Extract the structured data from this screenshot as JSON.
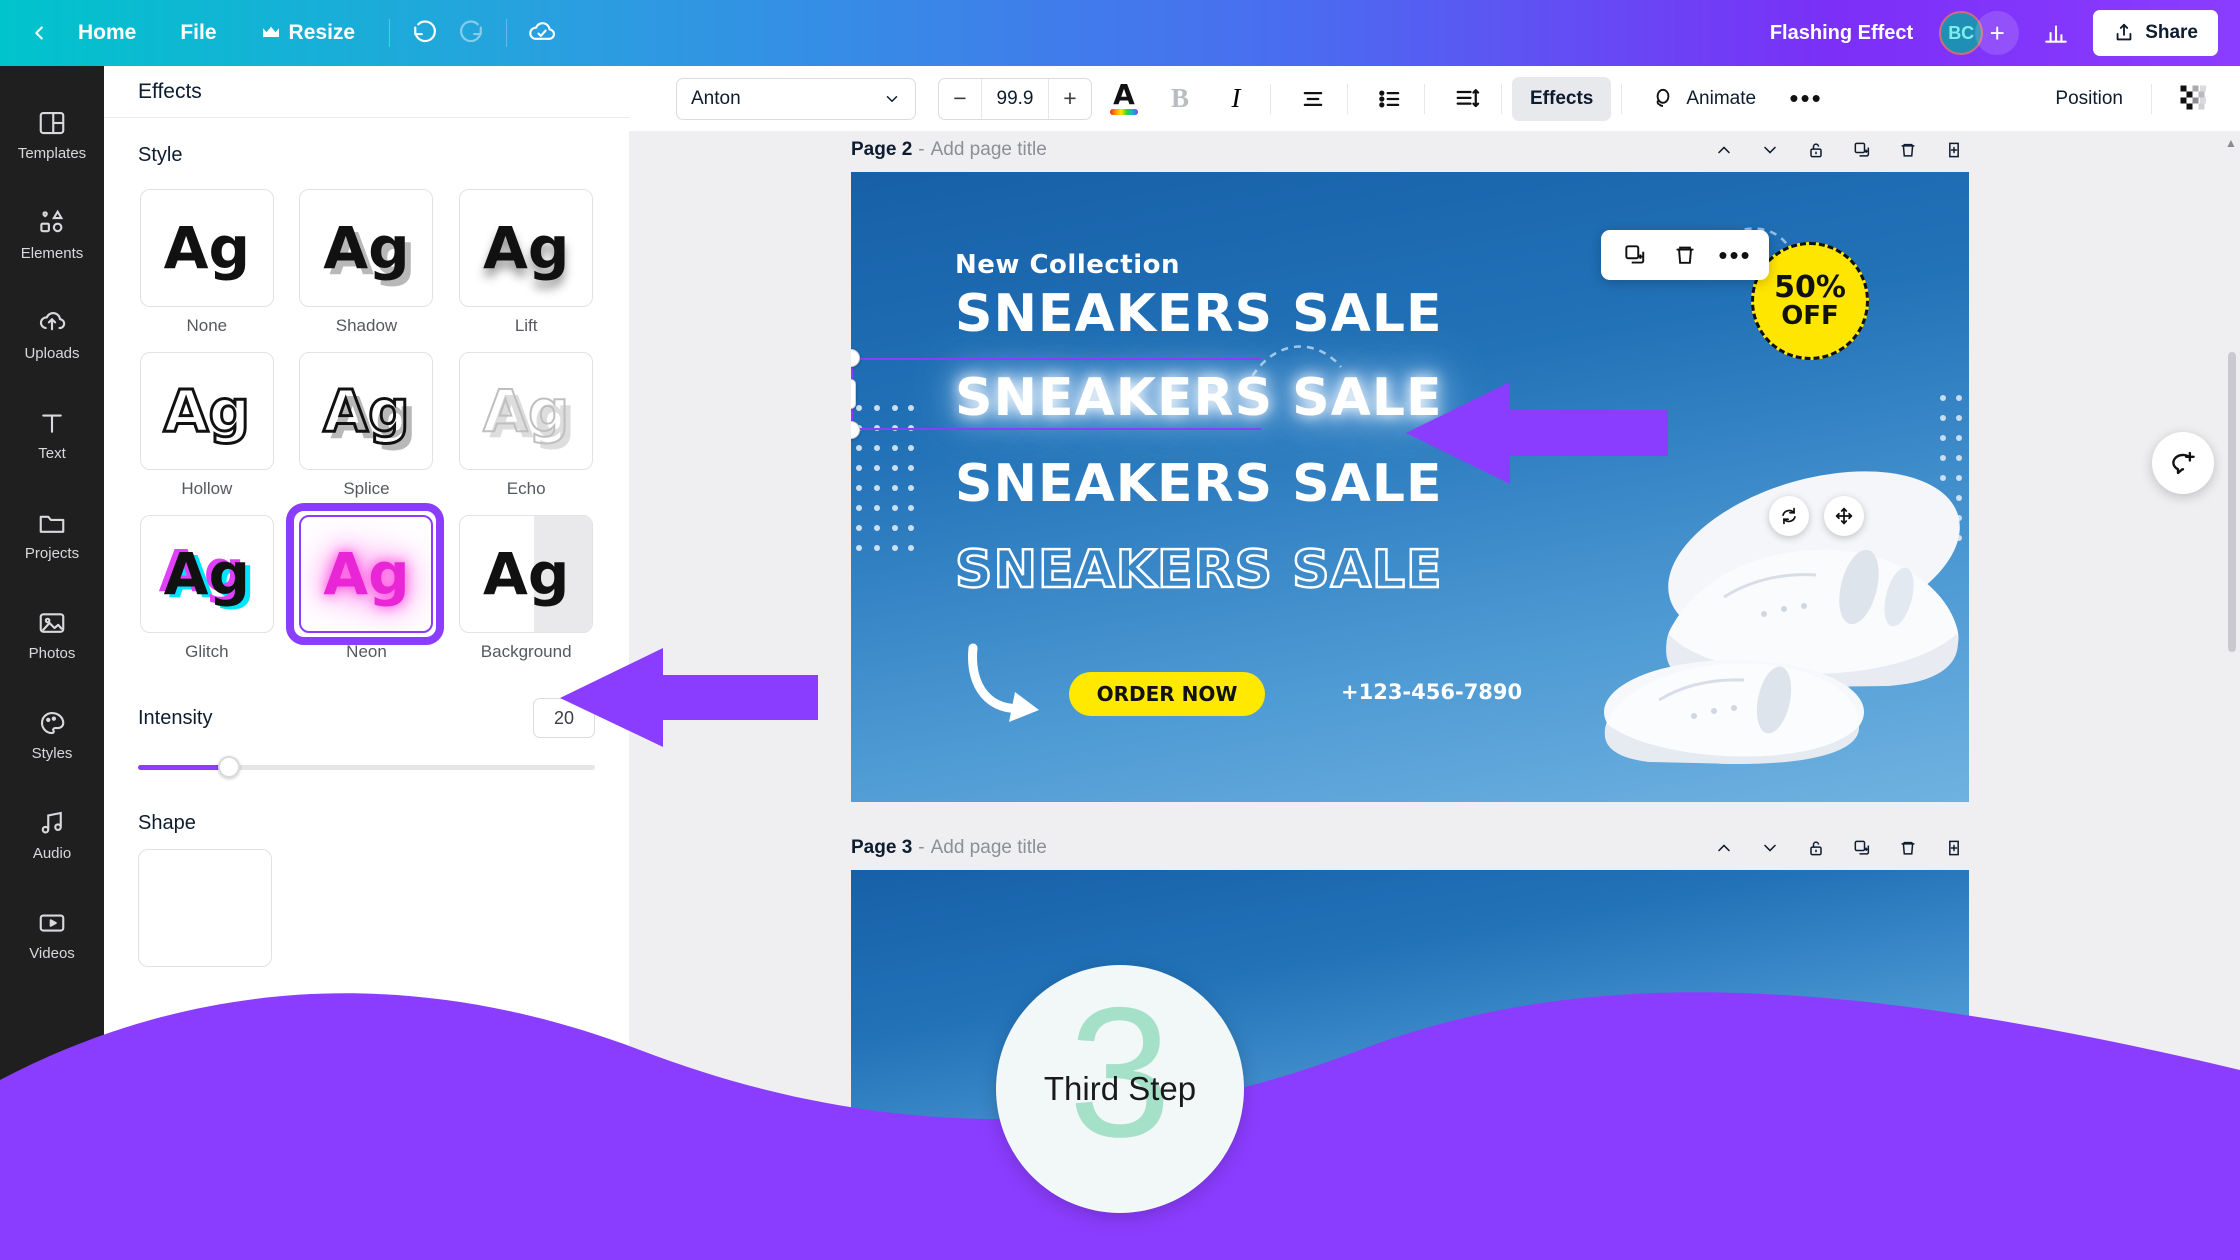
{
  "topbar": {
    "back_icon": "chevron-left-icon",
    "home": "Home",
    "file": "File",
    "resize": "Resize",
    "resize_icon": "crown-icon",
    "undo_icon": "undo-icon",
    "redo_icon": "redo-icon",
    "cloud_icon": "cloud-saved-icon",
    "doc_title": "Flashing Effect",
    "avatar_initials": "BC",
    "plus_icon": "plus-icon",
    "chart_icon": "insights-icon",
    "share_label": "Share",
    "share_icon": "share-upload-icon",
    "accent_gradient_start": "#00c4cc",
    "accent_gradient_end": "#8b3dff"
  },
  "rail": {
    "items": [
      {
        "label": "Templates",
        "icon": "templates-icon"
      },
      {
        "label": "Elements",
        "icon": "elements-icon"
      },
      {
        "label": "Uploads",
        "icon": "uploads-icon"
      },
      {
        "label": "Text",
        "icon": "text-icon"
      },
      {
        "label": "Projects",
        "icon": "projects-folder-icon"
      },
      {
        "label": "Photos",
        "icon": "photos-icon"
      },
      {
        "label": "Styles",
        "icon": "styles-palette-icon"
      },
      {
        "label": "Audio",
        "icon": "audio-note-icon"
      },
      {
        "label": "Videos",
        "icon": "videos-play-icon"
      }
    ]
  },
  "panel": {
    "title": "Effects",
    "style_section": "Style",
    "styles": [
      {
        "label": "None",
        "selected": false
      },
      {
        "label": "Shadow",
        "selected": false
      },
      {
        "label": "Lift",
        "selected": false
      },
      {
        "label": "Hollow",
        "selected": false
      },
      {
        "label": "Splice",
        "selected": false
      },
      {
        "label": "Echo",
        "selected": false
      },
      {
        "label": "Glitch",
        "selected": false
      },
      {
        "label": "Neon",
        "selected": true
      },
      {
        "label": "Background",
        "selected": false
      }
    ],
    "sample_text": "Ag",
    "intensity_label": "Intensity",
    "intensity_value": "20",
    "shape_label": "Shape",
    "selection_color": "#8b3dff"
  },
  "toolbar": {
    "font_name": "Anton",
    "font_dropdown_icon": "chevron-down-icon",
    "decrease_icon": "minus-icon",
    "font_size": "99.9",
    "increase_icon": "plus-icon",
    "text_color_icon": "text-color-icon",
    "bold_label": "B",
    "italic_label": "I",
    "align_icon": "align-center-icon",
    "list_icon": "bullet-list-icon",
    "spacing_icon": "line-spacing-icon",
    "effects_label": "Effects",
    "animate_label": "Animate",
    "animate_icon": "animate-icon",
    "more_icon": "more-horizontal-icon",
    "position_label": "Position",
    "grid_icon": "transparency-grid-icon"
  },
  "canvas": {
    "pages": [
      {
        "name": "Page 2",
        "separator": "-",
        "add_title": "Add page title",
        "actions": [
          {
            "icon": "chevron-up-icon",
            "name": "move-page-up"
          },
          {
            "icon": "chevron-down-icon",
            "name": "move-page-down"
          },
          {
            "icon": "lock-icon",
            "name": "lock-page"
          },
          {
            "icon": "duplicate-icon",
            "name": "duplicate-page"
          },
          {
            "icon": "trash-icon",
            "name": "delete-page"
          },
          {
            "icon": "add-page-icon",
            "name": "add-page"
          }
        ]
      },
      {
        "name": "Page 3",
        "separator": "-",
        "add_title": "Add page title",
        "actions": [
          {
            "icon": "chevron-up-icon",
            "name": "move-page-up"
          },
          {
            "icon": "chevron-down-icon",
            "name": "move-page-down"
          },
          {
            "icon": "lock-icon",
            "name": "lock-page"
          },
          {
            "icon": "duplicate-icon",
            "name": "duplicate-page"
          },
          {
            "icon": "trash-icon",
            "name": "delete-page"
          },
          {
            "icon": "add-page-icon",
            "name": "add-page"
          }
        ]
      }
    ],
    "design": {
      "eyebrow": "New Collection",
      "headline_1": "SNEAKERS SALE",
      "headline_2": "SNEAKERS SALE",
      "headline_3": "SNEAKERS SALE",
      "headline_4": "SNEAKERS SALE",
      "cta_label": "ORDER NOW",
      "phone": "+123-456-7890",
      "badge_top": "50%",
      "badge_bottom": "OFF",
      "cta_color": "#ffe900",
      "badge_color": "#ffe600"
    },
    "selection_toolbar": [
      {
        "icon": "duplicate-icon",
        "name": "duplicate-element"
      },
      {
        "icon": "trash-icon",
        "name": "delete-element"
      },
      {
        "icon": "more-horizontal-icon",
        "name": "element-more"
      }
    ],
    "handles": [
      {
        "icon": "rotate-icon",
        "name": "rotate-handle"
      },
      {
        "icon": "move-icon",
        "name": "move-handle"
      }
    ],
    "comment_fab_icon": "add-comment-icon"
  },
  "overlay": {
    "step_number": "3",
    "step_label": "Third Step",
    "wave_color": "#8b3dff",
    "badge_number_color": "#a5e0c8",
    "arrow_color": "#8b3dff"
  }
}
